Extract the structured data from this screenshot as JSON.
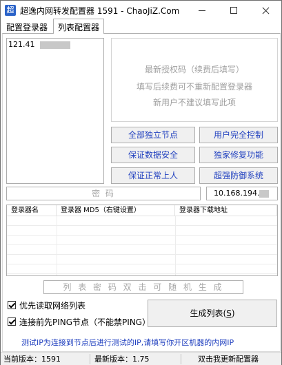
{
  "app": {
    "icon_glyph": "超",
    "title": "超逸内网转发配置器 1591  -  ChaoJiZ.Com"
  },
  "tabs": [
    {
      "label": "配置登录器",
      "active": false
    },
    {
      "label": "列表配置器",
      "active": true
    }
  ],
  "server_list": {
    "items": [
      {
        "text": "121.41"
      }
    ]
  },
  "auth_notes": {
    "lines": [
      "最新授权码（续费后填写）",
      "填写后续费可不重新配置登录器",
      "新用户不建议填写此项"
    ]
  },
  "feature_buttons": [
    "全部独立节点",
    "用户完全控制",
    "保证数据安全",
    "独家修复功能",
    "保证正常上人",
    "超强防御系统"
  ],
  "password_field": {
    "placeholder": "密    码"
  },
  "ip_field": {
    "value": "10.168.194."
  },
  "login_table": {
    "columns": [
      "登录器名",
      "登录器 MD5（右键设置）",
      "登录器下载地址"
    ],
    "rows": []
  },
  "list_password_field": {
    "placeholder": "列 表 密 码   双 击 可 随 机 生 成"
  },
  "options": [
    {
      "label": "优先读取网络列表",
      "checked": true
    },
    {
      "label": "连接前先PING节点（不能禁PING）",
      "checked": true
    }
  ],
  "generate_button": {
    "prefix": "生成列表(",
    "mnemonic": "S",
    "suffix": ")"
  },
  "info_text": "测试IP为连接到节点后进行测试的IP,请填写你开区机器的内网IP",
  "status_bar": {
    "current_version": "当前版本：1591",
    "latest_version": "最新版本：1.75",
    "update_link": "双击我更新配置器"
  },
  "colors": {
    "accent_text": "#1f3fbf",
    "placeholder": "#a8a8a8",
    "icon_bg": "#2b63c9"
  }
}
